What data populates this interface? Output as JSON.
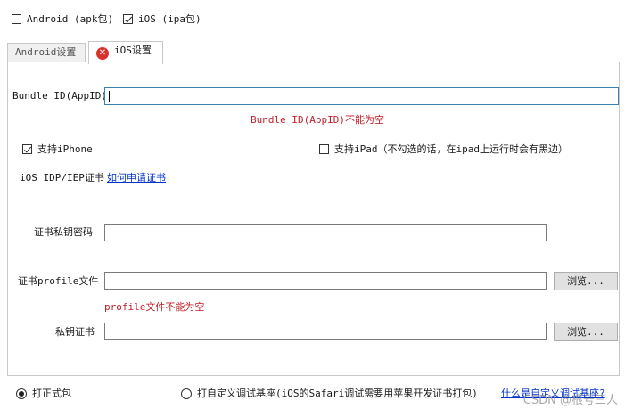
{
  "platforms": {
    "android_label": "Android (apk包)",
    "android_checked": false,
    "ios_label": "iOS (ipa包)",
    "ios_checked": true
  },
  "tabs": [
    {
      "label": "Android设置",
      "active": false
    },
    {
      "label": "iOS设置",
      "active": true,
      "icon": "error-icon"
    }
  ],
  "ios": {
    "bundle_id_label": "Bundle ID(AppID)",
    "bundle_id_value": "",
    "bundle_id_error": "Bundle ID(AppID)不能为空",
    "support_iphone_label": "支持iPhone",
    "support_iphone_checked": true,
    "support_ipad_label": "支持iPad（不勾选的话，在ipad上运行时会有黑边）",
    "support_ipad_checked": false,
    "cert_label": "iOS IDP/IEP证书",
    "cert_link": "如何申请证书",
    "cert_password_label": "证书私钥密码",
    "cert_password_value": "",
    "profile_label": "证书profile文件",
    "profile_value": "",
    "profile_browse": "浏览...",
    "profile_error": "profile文件不能为空",
    "private_key_label": "私钥证书",
    "private_key_value": "",
    "private_key_browse": "浏览..."
  },
  "package_type": {
    "release_label": "打正式包",
    "release_selected": true,
    "custom_base_label": "打自定义调试基座(iOS的Safari调试需要用苹果开发证书打包)",
    "custom_base_selected": false,
    "custom_base_help_link": "什么是自定义调试基座?"
  },
  "watermark": "CSDN @根号三人"
}
